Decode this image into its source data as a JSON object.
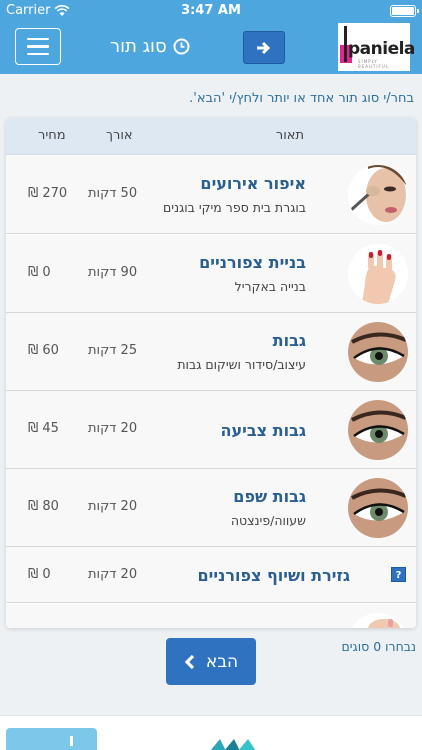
{
  "status_bar": {
    "carrier": "Carrier",
    "time": "3:47 AM"
  },
  "nav": {
    "title": "סוג תור",
    "brand": "paniela",
    "brand_tagline": "SIMPLY BEAUTIFUL"
  },
  "instruction": "בחר/י סוג תור אחד או יותר ולחץ/י 'הבא'.",
  "table": {
    "headers": {
      "description": "תאור",
      "length": "אורך",
      "price": "מחיר"
    },
    "rows": [
      {
        "name": "איפור אירועים",
        "sub": "בוגרת בית ספר מיקי בוגנים",
        "length": "50 דקות",
        "price": "270 ₪",
        "image": "makeup"
      },
      {
        "name": "בניית צפורניים",
        "sub": "בנייה באקריל",
        "length": "90 דקות",
        "price": "0 ₪",
        "image": "nails"
      },
      {
        "name": "גבות",
        "sub": "עיצוב/סידור ושיקום גבות",
        "length": "25 דקות",
        "price": "60 ₪",
        "image": "eye"
      },
      {
        "name": "גבות צביעה",
        "sub": "",
        "length": "20 דקות",
        "price": "45 ₪",
        "image": "eye"
      },
      {
        "name": "גבות שפם",
        "sub": "שעווה/פינצטה",
        "length": "20 דקות",
        "price": "80 ₪",
        "image": "eye"
      },
      {
        "name": "גזירת ושיוף צפורניים",
        "sub": "",
        "length": "20 דקות",
        "price": "0 ₪",
        "image": "none"
      }
    ]
  },
  "footer": {
    "selected_count": "נבחרו 0 סוגים",
    "next_label": "הבא"
  },
  "colors": {
    "nav": "#4ea6de",
    "accent": "#2f73c0",
    "title_text": "#2a5f8f"
  }
}
